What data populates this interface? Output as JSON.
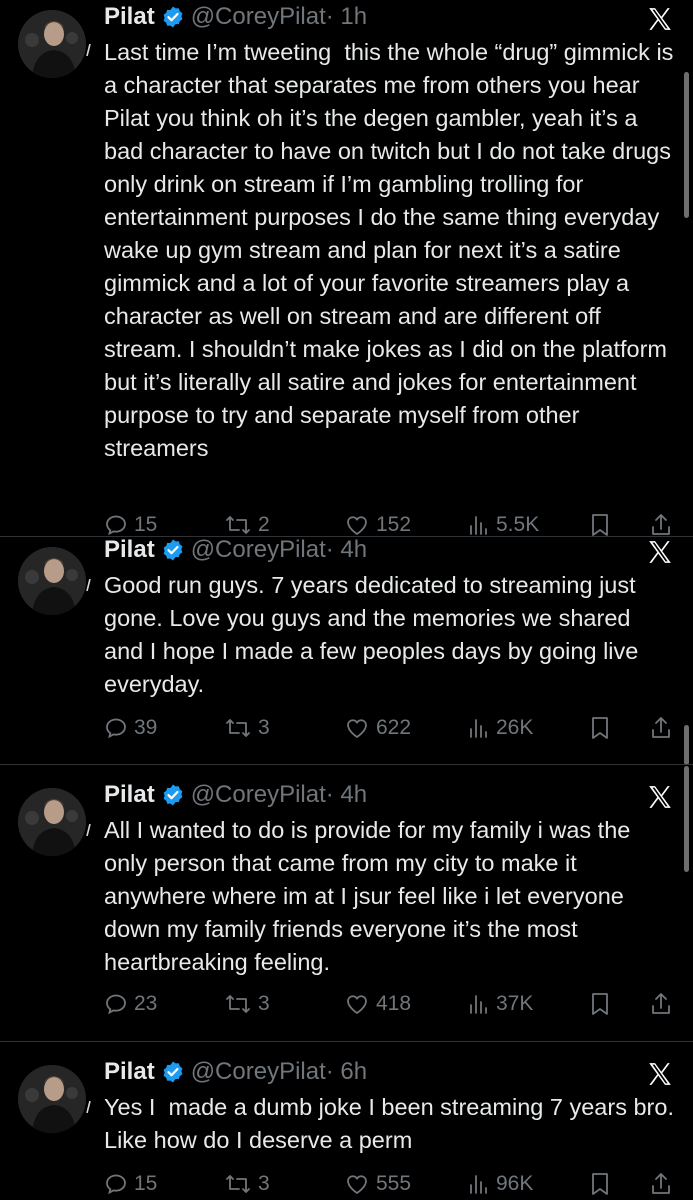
{
  "account": {
    "name": "Pilat",
    "handle": "@CoreyPilat",
    "avatar_icon": "profile-photo-icon",
    "verified_color": "#1d9bf0"
  },
  "tweets": [
    {
      "time": "· 1h",
      "text": "Last time I’m tweeting  this the whole “drug” gimmick is a character that separates me from others you hear Pilat you think oh it’s the degen gambler, yeah it’s a bad character to have on twitch but I do not take drugs only drink on stream if I’m gambling trolling for entertainment purposes I do the same thing everyday wake up gym stream and plan for next it’s a satire gimmick and a lot of your favorite streamers play a character as well on stream and are different off stream. I shouldn’t make jokes as I did on the platform but it’s literally all satire and jokes for entertainment purpose to try and separate myself from other streamers",
      "replies": "15",
      "reposts": "2",
      "likes": "152",
      "views": "5.5K"
    },
    {
      "time": "· 4h",
      "text": "Good run guys. 7 years dedicated to streaming just gone. Love you guys and the memories we shared and I hope I made a few peoples days by going live everyday.",
      "replies": "39",
      "reposts": "3",
      "likes": "622",
      "views": "26K"
    },
    {
      "time": "· 4h",
      "text": "All I wanted to do is provide for my family i was the only person that came from my city to make it anywhere where im at I jsur feel like i let everyone down my family friends everyone it’s the most heartbreaking feeling.",
      "replies": "23",
      "reposts": "3",
      "likes": "418",
      "views": "37K"
    },
    {
      "time": "· 6h",
      "text": "Yes I  made a dumb joke I been streaming 7 years bro. Like how do I deserve a perm",
      "replies": "15",
      "reposts": "3",
      "likes": "555",
      "views": "96K"
    }
  ]
}
